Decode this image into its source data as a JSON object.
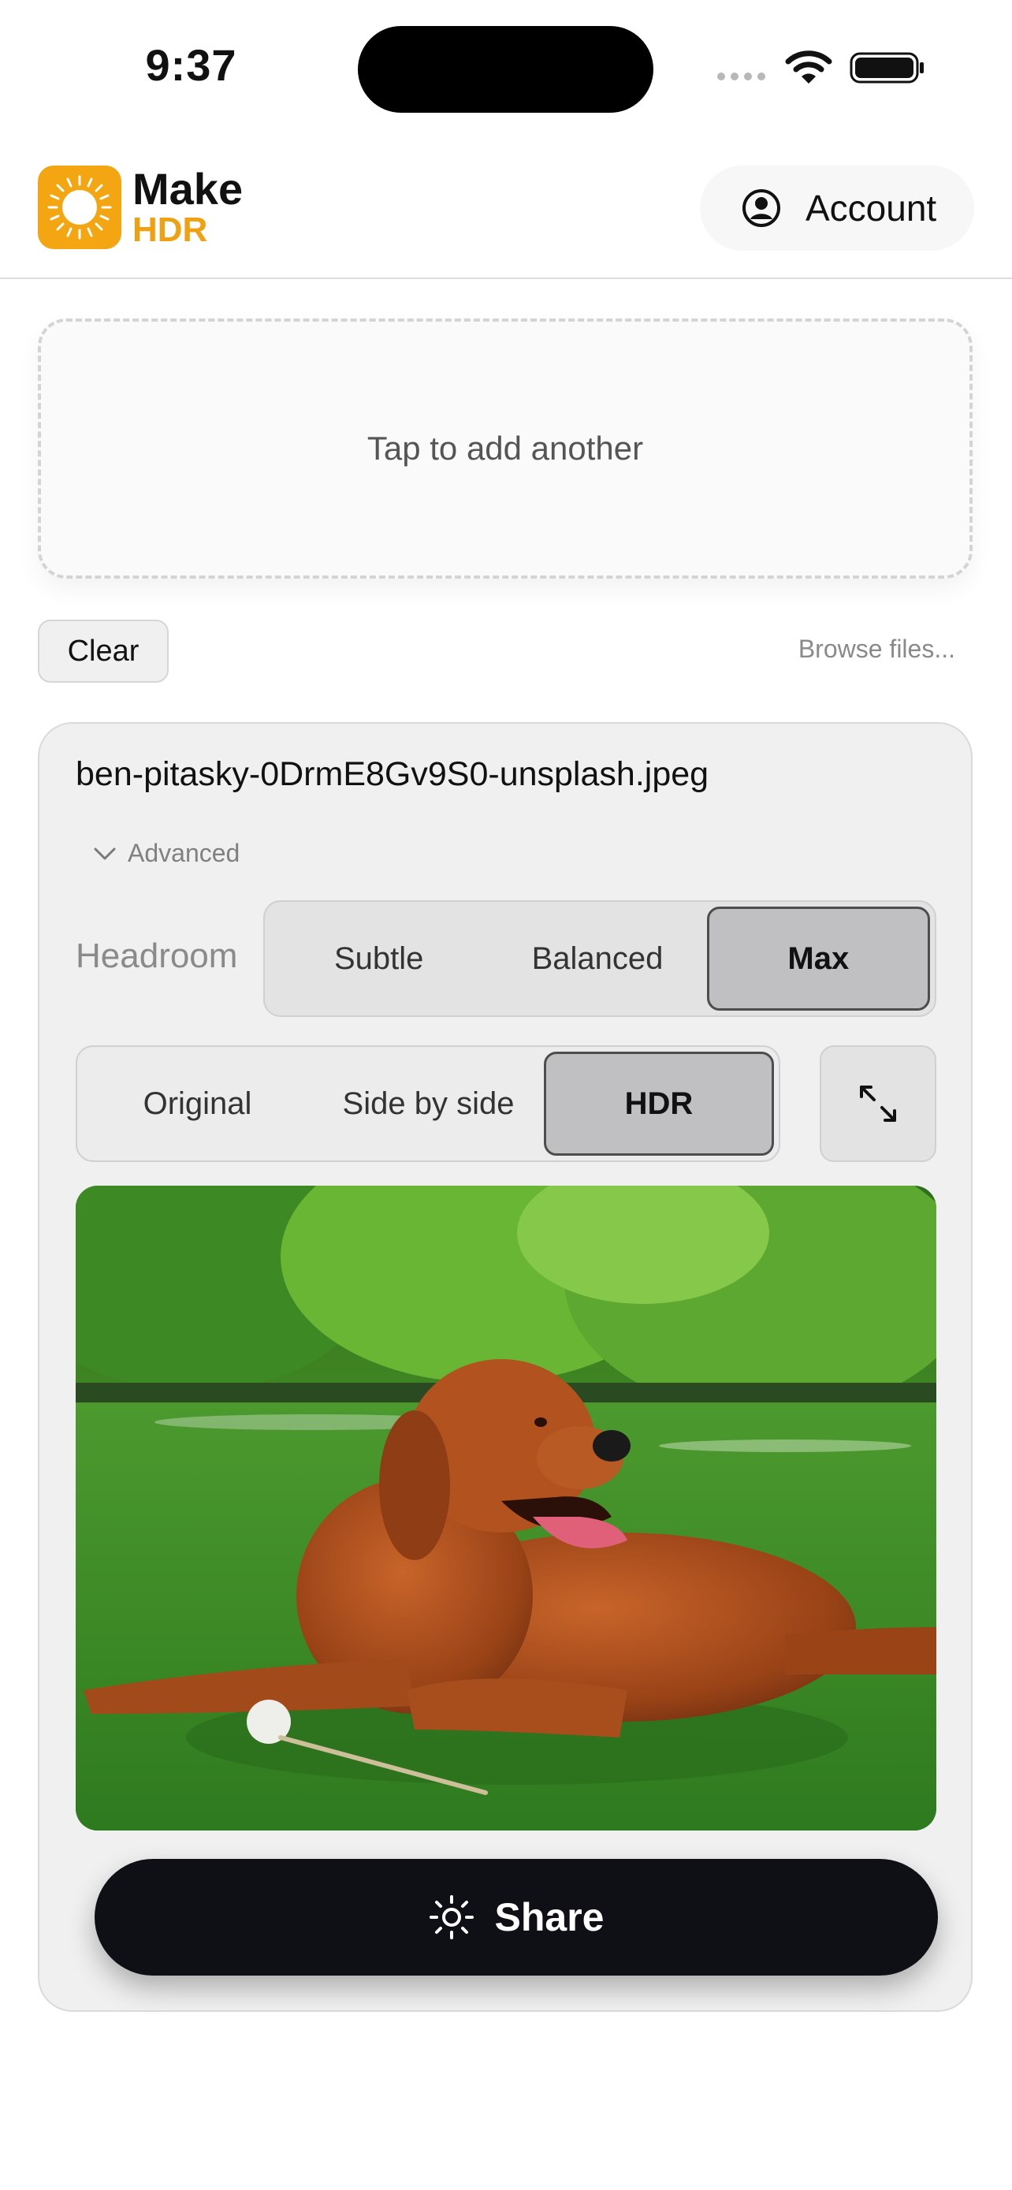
{
  "status_bar": {
    "time": "9:37",
    "icons": [
      "signal-dots-icon",
      "wifi-icon",
      "battery-icon"
    ]
  },
  "header": {
    "logo_icon": "sun-logo-icon",
    "brand_line1": "Make",
    "brand_line2": "HDR",
    "account_icon": "person-circle-icon",
    "account_label": "Account"
  },
  "dropzone": {
    "text": "Tap to add another"
  },
  "actions": {
    "clear_label": "Clear",
    "browse_label": "Browse files..."
  },
  "card": {
    "file_name": "ben-pitasky-0DrmE8Gv9S0-unsplash.jpeg",
    "advanced_icon": "chevron-down-icon",
    "advanced_label": "Advanced",
    "headroom": {
      "label": "Headroom",
      "options": [
        "Subtle",
        "Balanced",
        "Max"
      ],
      "selected": "Max"
    },
    "view_mode": {
      "options": [
        "Original",
        "Side by side",
        "HDR"
      ],
      "selected": "HDR"
    },
    "expand_icon": "expand-arrows-icon",
    "image_alt": "golden retriever lying on grass",
    "share_icon": "sun-icon",
    "share_label": "Share"
  },
  "colors": {
    "brand_orange": "#f3a512",
    "share_button": "#0f0f16",
    "card_bg": "#f0f0f0"
  }
}
